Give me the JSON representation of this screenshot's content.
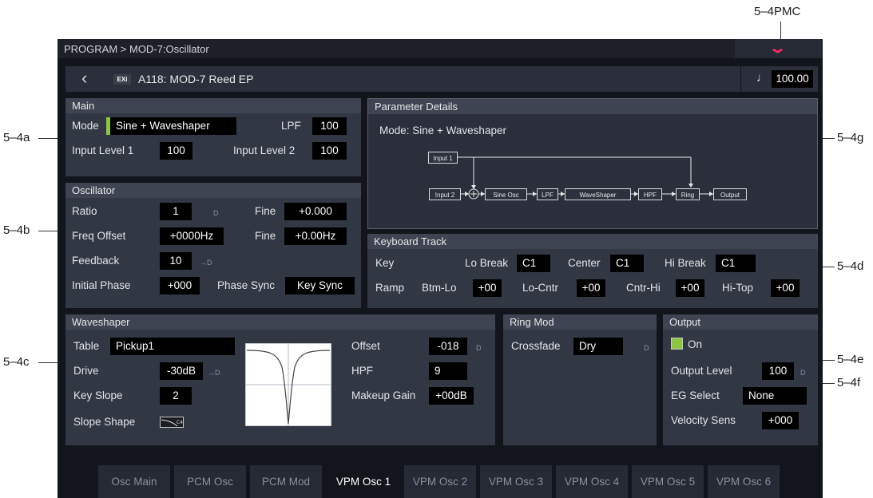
{
  "callouts": {
    "pmc": "5–4PMC",
    "a": "5–4a",
    "b": "5–4b",
    "c": "5–4c",
    "d": "5–4d",
    "e": "5–4e",
    "f": "5–4f",
    "g": "5–4g"
  },
  "title": "PROGRAM > MOD-7:Oscillator",
  "header": {
    "back_icon": "chevron-left-icon",
    "exi_badge": "EXi",
    "program_name": "A118: MOD-7 Reed EP",
    "tempo_icon": "note-icon",
    "tempo": "100.00"
  },
  "main": {
    "heading": "Main",
    "mode_label": "Mode",
    "mode_value": "Sine + Waveshaper",
    "lpf_label": "LPF",
    "lpf_value": "100",
    "input1_label": "Input Level 1",
    "input1_value": "100",
    "input2_label": "Input Level 2",
    "input2_value": "100"
  },
  "oscillator": {
    "heading": "Oscillator",
    "ratio_label": "Ratio",
    "ratio_value": "1",
    "ratio_d": "D",
    "fine1_label": "Fine",
    "fine1_value": "+0.000",
    "freq_label": "Freq Offset",
    "freq_value": "+0000Hz",
    "fine2_label": "Fine",
    "fine2_value": "+0.00Hz",
    "feedback_label": "Feedback",
    "feedback_value": "10",
    "feedback_d": "→D",
    "phase_label": "Initial Phase",
    "phase_value": "+000",
    "sync_label": "Phase Sync",
    "sync_value": "Key Sync"
  },
  "details": {
    "heading": "Parameter Details",
    "mode_text": "Mode: Sine + Waveshaper",
    "diagram": {
      "input1": "Input 1",
      "input2": "Input 2",
      "sine": "Sine Osc",
      "lpf": "LPF",
      "waveshaper": "WaveShaper",
      "hpf": "HPF",
      "ring": "Ring",
      "output": "Output"
    }
  },
  "keytrack": {
    "heading": "Keyboard Track",
    "key_label": "Key",
    "lobreak_label": "Lo Break",
    "lobreak_value": "C1",
    "center_label": "Center",
    "center_value": "C1",
    "hibreak_label": "Hi Break",
    "hibreak_value": "C1",
    "ramp_label": "Ramp",
    "btmlo_label": "Btm-Lo",
    "btmlo_value": "+00",
    "locntr_label": "Lo-Cntr",
    "locntr_value": "+00",
    "cntrhi_label": "Cntr-Hi",
    "cntrhi_value": "+00",
    "hitop_label": "Hi-Top",
    "hitop_value": "+00"
  },
  "waveshaper": {
    "heading": "Waveshaper",
    "table_label": "Table",
    "table_value": "Pickup1",
    "drive_label": "Drive",
    "drive_value": "-30dB",
    "drive_d": "→D",
    "keyslope_label": "Key Slope",
    "keyslope_value": "2",
    "slopeshape_label": "Slope Shape",
    "offset_label": "Offset",
    "offset_value": "-018",
    "offset_d": "D",
    "hpf_label": "HPF",
    "hpf_value": "9",
    "makeup_label": "Makeup Gain",
    "makeup_value": "+00dB"
  },
  "ringmod": {
    "heading": "Ring Mod",
    "crossfade_label": "Crossfade",
    "crossfade_value": "Dry",
    "crossfade_d": "D"
  },
  "output": {
    "heading": "Output",
    "on_label": "On",
    "on_checked": true,
    "level_label": "Output Level",
    "level_value": "100",
    "level_d": "D",
    "eg_label": "EG Select",
    "eg_value": "None",
    "vel_label": "Velocity Sens",
    "vel_value": "+000"
  },
  "tabs": [
    "Osc Main",
    "PCM Osc",
    "PCM Mod",
    "VPM Osc 1",
    "VPM Osc 2",
    "VPM Osc 3",
    "VPM Osc 4",
    "VPM Osc 5",
    "VPM Osc 6"
  ],
  "active_tab": "VPM Osc 1",
  "colors": {
    "accent": "#ff2a66",
    "checkbox": "#8cc63f",
    "panel": "#323744",
    "field": "#000000"
  }
}
